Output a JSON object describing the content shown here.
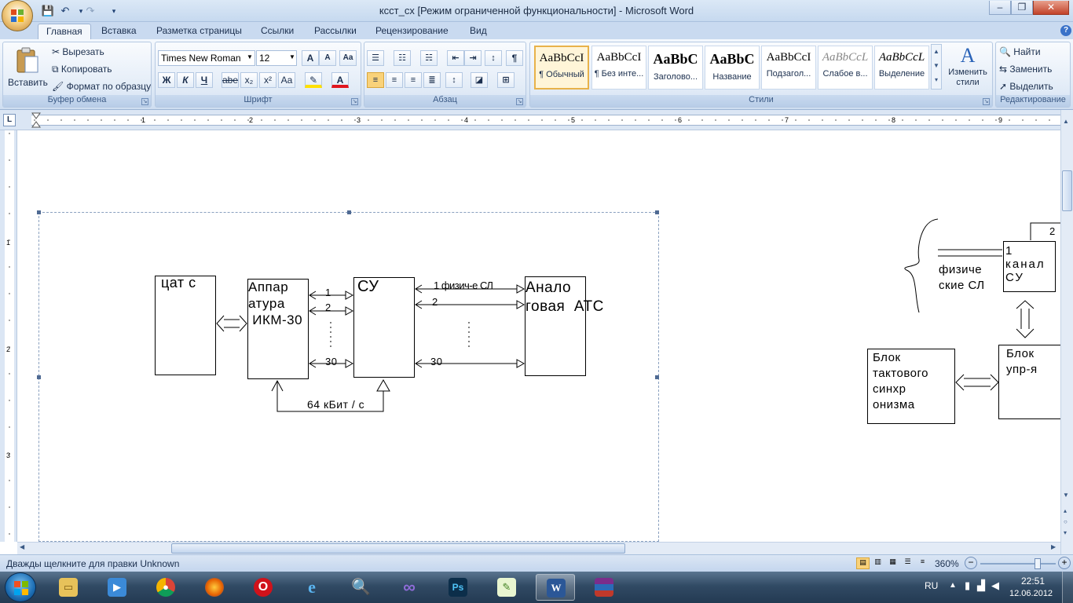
{
  "window": {
    "title": "ксст_сх [Режим ограниченной функциональности] - Microsoft Word",
    "controls": {
      "minimize": "‒",
      "maximize": "❐",
      "close": "✕"
    }
  },
  "quick_access": [
    "save-icon",
    "undo-icon",
    "redo-icon",
    "customize-icon"
  ],
  "tabs": [
    "Главная",
    "Вставка",
    "Разметка страницы",
    "Ссылки",
    "Рассылки",
    "Рецензирование",
    "Вид"
  ],
  "active_tab": "Главная",
  "ribbon": {
    "clipboard": {
      "label": "Буфер обмена",
      "paste": "Вставить",
      "cut": "Вырезать",
      "copy": "Копировать",
      "format_painter": "Формат по образцу"
    },
    "font": {
      "label": "Шрифт",
      "font_name": "Times New Roman",
      "font_size": "12",
      "bold": "Ж",
      "italic": "К",
      "underline": "Ч",
      "strike": "abe",
      "subscript": "x₂",
      "superscript": "x²",
      "change_case": "Aa",
      "grow": "A",
      "shrink": "A",
      "clear": "Aa"
    },
    "paragraph": {
      "label": "Абзац",
      "pilcrow": "¶"
    },
    "styles": {
      "label": "Стили",
      "items": [
        {
          "sample": "AaBbCcI",
          "name": "¶ Обычный"
        },
        {
          "sample": "AaBbCcI",
          "name": "¶ Без инте..."
        },
        {
          "sample": "AaBbC",
          "name": "Заголово..."
        },
        {
          "sample": "AaBbC",
          "name": "Название"
        },
        {
          "sample": "AaBbCcI",
          "name": "Подзагол..."
        },
        {
          "sample": "AaBbCcL",
          "name": "Слабое в..."
        },
        {
          "sample": "AaBbCcL",
          "name": "Выделение"
        }
      ],
      "change_styles": "Изменить стили"
    },
    "editing": {
      "label": "Редактирование",
      "find": "Найти",
      "replace": "Заменить",
      "select": "Выделить"
    }
  },
  "ruler": {
    "marks": [
      "1",
      "2",
      "3",
      "4",
      "5",
      "6",
      "7",
      "8",
      "9"
    ],
    "v_marks": [
      "1",
      "2",
      "3"
    ]
  },
  "diagram_left": {
    "box_a": "цат с",
    "box_b": "Аппар\nатура\n ИКМ-30",
    "box_c": "СУ",
    "box_d": "Анало\nговая  АТС",
    "link_labels": [
      "1",
      "2",
      "30"
    ],
    "chan_label_1": "1 физич-е СЛ",
    "chan_label_2": "2",
    "chan_label_30": "30",
    "bottom_label": "64 кБит / с"
  },
  "diagram_right": {
    "brace_text": "физиче\nские СЛ",
    "box_channel": "1\nканал\nСУ",
    "box_sync": "Блок\nтактового\nсинхр\nонизма",
    "box_ctrl": "Блок\nупр-я",
    "corner_label": "2"
  },
  "status": {
    "text": "Дважды щелкните для правки Unknown",
    "zoom": "360%"
  },
  "taskbar": {
    "apps": [
      "start-orb",
      "explorer",
      "media-player",
      "chrome",
      "firefox",
      "opera",
      "ie",
      "search-tool",
      "visual-studio",
      "photoshop",
      "notepad-plus",
      "word",
      "winrar"
    ],
    "lang": "RU",
    "time": "22:51",
    "date": "12.06.2012"
  },
  "colors": {
    "ribbon_bg": "#dde8f5",
    "titlebar": "#c6d9ef",
    "taskbar": "#233a52",
    "accent": "#e8b24a"
  }
}
